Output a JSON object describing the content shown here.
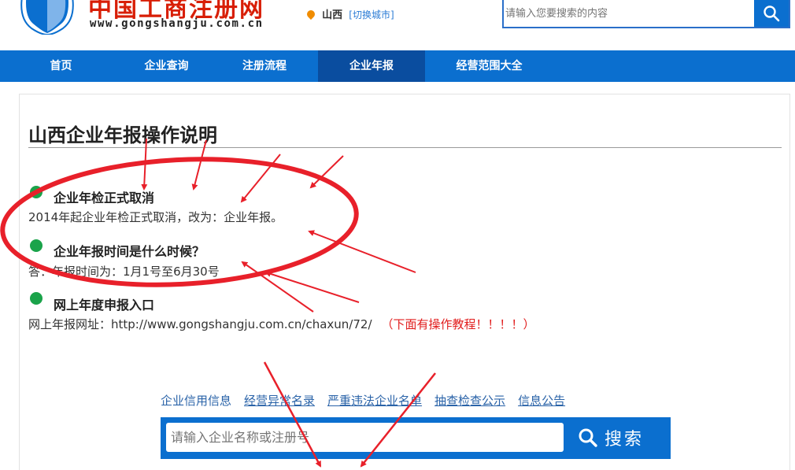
{
  "header": {
    "logo_title": "中国工商注册网",
    "logo_url": "www.gongshangju.com.cn",
    "city": "山西",
    "city_switch": "[切换城市]",
    "search_placeholder": "请输入您要搜索的内容"
  },
  "nav": {
    "items": [
      {
        "label": "首页"
      },
      {
        "label": "企业查询"
      },
      {
        "label": "注册流程"
      },
      {
        "label": "企业年报",
        "active": true
      },
      {
        "label": "经营范围大全"
      }
    ]
  },
  "main": {
    "title": "山西企业年报操作说明",
    "items": [
      {
        "heading": "企业年检正式取消",
        "text": "2014年起企业年检正式取消，改为：企业年报。"
      },
      {
        "heading": "企业年报时间是什么时候？",
        "text": "答：年报时间为：1月1号至6月30号"
      },
      {
        "heading": "网上年度申报入口",
        "text": "网上年报网址：http://www.gongshangju.com.cn/chaxun/72/",
        "note": "（下面有操作教程！！！！）"
      }
    ]
  },
  "bottom": {
    "links": [
      "企业信用信息",
      "经营异常名录",
      "严重违法企业名单",
      "抽查检查公示",
      "信息公告"
    ],
    "search_placeholder": "请输入企业名称或注册号",
    "search_button": "搜索"
  },
  "colors": {
    "brand_blue": "#0b6fcf",
    "nav_active": "#0a4d9f",
    "logo_red": "#d81e06",
    "bullet_green": "#1aa34a",
    "annotation_red": "#e8202a",
    "link_blue": "#2a63a8"
  }
}
